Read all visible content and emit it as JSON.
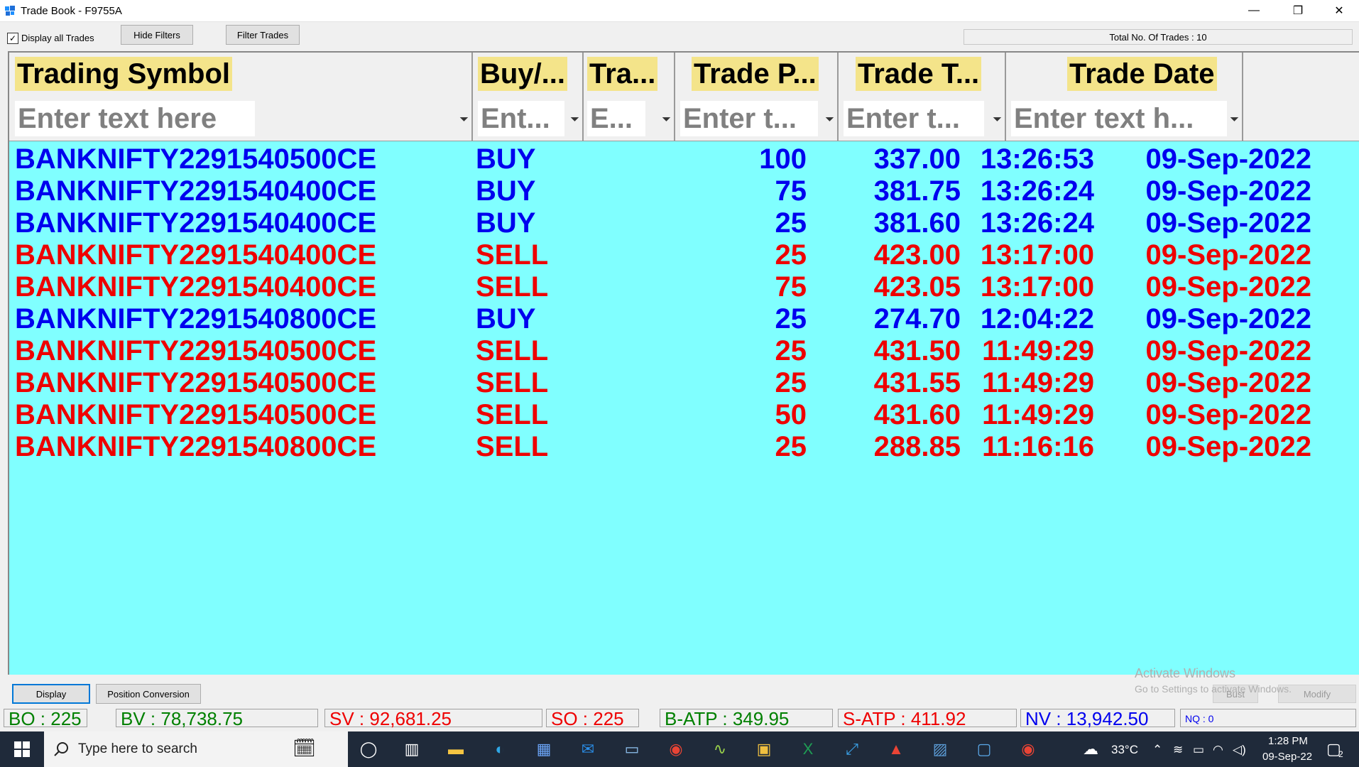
{
  "window": {
    "title": "Trade Book - F9755A",
    "minimize": "—",
    "restore": "❐",
    "close": "✕"
  },
  "toolbar": {
    "display_all_label": "Display all Trades",
    "display_all_checked": true,
    "hide_filters_label": "Hide Filters",
    "filter_trades_label": "Filter Trades",
    "total_trades": "Total No. Of Trades : 10"
  },
  "table": {
    "headers": [
      "Trading Symbol",
      "Buy/...",
      "Tra...",
      "Trade P...",
      "Trade T...",
      "Trade Date"
    ],
    "filters": [
      "Enter text here",
      "Ent...",
      "E...",
      "Enter t...",
      "Enter t...",
      "Enter text h..."
    ],
    "rows": [
      {
        "symbol": "BANKNIFTY2291540500CE",
        "side": "BUY",
        "qty": "100",
        "price": "337.00",
        "time": "13:26:53",
        "date": "09-Sep-2022",
        "type": "buy"
      },
      {
        "symbol": "BANKNIFTY2291540400CE",
        "side": "BUY",
        "qty": "75",
        "price": "381.75",
        "time": "13:26:24",
        "date": "09-Sep-2022",
        "type": "buy"
      },
      {
        "symbol": "BANKNIFTY2291540400CE",
        "side": "BUY",
        "qty": "25",
        "price": "381.60",
        "time": "13:26:24",
        "date": "09-Sep-2022",
        "type": "buy"
      },
      {
        "symbol": "BANKNIFTY2291540400CE",
        "side": "SELL",
        "qty": "25",
        "price": "423.00",
        "time": "13:17:00",
        "date": "09-Sep-2022",
        "type": "sell"
      },
      {
        "symbol": "BANKNIFTY2291540400CE",
        "side": "SELL",
        "qty": "75",
        "price": "423.05",
        "time": "13:17:00",
        "date": "09-Sep-2022",
        "type": "sell"
      },
      {
        "symbol": "BANKNIFTY2291540800CE",
        "side": "BUY",
        "qty": "25",
        "price": "274.70",
        "time": "12:04:22",
        "date": "09-Sep-2022",
        "type": "buy"
      },
      {
        "symbol": "BANKNIFTY2291540500CE",
        "side": "SELL",
        "qty": "25",
        "price": "431.50",
        "time": "11:49:29",
        "date": "09-Sep-2022",
        "type": "sell"
      },
      {
        "symbol": "BANKNIFTY2291540500CE",
        "side": "SELL",
        "qty": "25",
        "price": "431.55",
        "time": "11:49:29",
        "date": "09-Sep-2022",
        "type": "sell"
      },
      {
        "symbol": "BANKNIFTY2291540500CE",
        "side": "SELL",
        "qty": "50",
        "price": "431.60",
        "time": "11:49:29",
        "date": "09-Sep-2022",
        "type": "sell"
      },
      {
        "symbol": "BANKNIFTY2291540800CE",
        "side": "SELL",
        "qty": "25",
        "price": "288.85",
        "time": "11:16:16",
        "date": "09-Sep-2022",
        "type": "sell"
      }
    ]
  },
  "bottom": {
    "display_label": "Display",
    "position_conversion_label": "Position Conversion",
    "bust_label": "Bust",
    "modify_label": "Modify",
    "activate_title": "Activate Windows",
    "activate_sub": "Go to Settings to activate Windows."
  },
  "status": {
    "bo": "BO : 225",
    "bv": "BV : 78,738.75",
    "sv": "SV : 92,681.25",
    "so": "SO : 225",
    "batp": "B-ATP : 349.95",
    "satp": "S-ATP : 411.92",
    "nv": "NV : 13,942.50",
    "nq": "NQ : 0"
  },
  "taskbar": {
    "search_placeholder": "Type here to search",
    "temperature": "33°C",
    "time": "1:28 PM",
    "date": "09-Sep-22",
    "notification_count": "2"
  },
  "colors": {
    "grid_bg": "#80ffff",
    "buy": "#0000ee",
    "sell": "#ee0000",
    "header_highlight": "#f4e48a"
  }
}
